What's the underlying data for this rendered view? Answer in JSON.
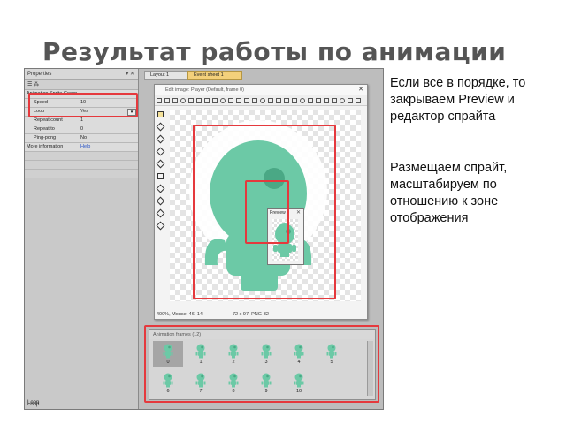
{
  "slide": {
    "title": "Результат работы по анимации",
    "text1": "Если все в порядке, то закрываем Preview и редактор спрайта",
    "text2": "Размещаем спрайт, масштабируем по отношению к зоне отображения"
  },
  "properties": {
    "header": "Properties",
    "toolbar_text": "☰ ⁂",
    "rows": [
      {
        "key": "Animation Sprite Group",
        "value": "",
        "style": "full"
      },
      {
        "key": "Speed",
        "value": "10",
        "style": ""
      },
      {
        "key": "Loop",
        "value": "Yes",
        "style": "dropdown"
      },
      {
        "key": "Repeat count",
        "value": "1",
        "style": ""
      },
      {
        "key": "Repeat to",
        "value": "0",
        "style": ""
      },
      {
        "key": "Ping-pong",
        "value": "No",
        "style": ""
      },
      {
        "key": "More information",
        "value": "Help",
        "style": "full blue"
      }
    ],
    "bottom_label": "Loop"
  },
  "tabs": [
    "Layout 1",
    "Event sheet 1"
  ],
  "editor": {
    "title": "Edit image: Player (Default, frame 0)",
    "status_left": "400%, Mouse: 46, 14",
    "status_right": "72 x 97, PNG-32"
  },
  "preview": {
    "title": "Preview"
  },
  "frames": {
    "title": "Animation frames (12)",
    "items": [
      "0",
      "1",
      "2",
      "3",
      "4",
      "5",
      "6",
      "7",
      "8",
      "9",
      "10"
    ],
    "selected_index": 0
  },
  "colors": {
    "highlight": "#e5393d",
    "sprite": "#6cc9a6",
    "sprite_dark": "#4aa885"
  }
}
